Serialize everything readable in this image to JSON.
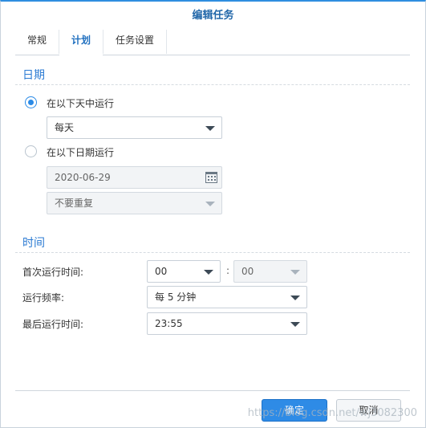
{
  "dialog": {
    "title": "编辑任务"
  },
  "tabs": [
    {
      "label": "常规",
      "active": false
    },
    {
      "label": "计划",
      "active": true
    },
    {
      "label": "任务设置",
      "active": false
    }
  ],
  "date_section": {
    "title": "日期",
    "option_daily": {
      "label": "在以下天中运行",
      "checked": true
    },
    "daily_select": {
      "value": "每天"
    },
    "option_specific": {
      "label": "在以下日期运行",
      "checked": false
    },
    "date_field": {
      "value": "2020-06-29"
    },
    "repeat_select": {
      "value": "不要重复"
    }
  },
  "time_section": {
    "title": "时间",
    "first_run": {
      "label": "首次运行时间:",
      "hour": "00",
      "separator": ":",
      "minute": "00"
    },
    "frequency": {
      "label": "运行频率:",
      "value": "每 5 分钟"
    },
    "last_run": {
      "label": "最后运行时间:",
      "value": "23:55"
    }
  },
  "footer": {
    "ok_label": "确定",
    "cancel_label": "取消"
  },
  "watermark": "https://blog.csdn.net/wj3082300",
  "colors": {
    "accent": "#2e8be6",
    "title": "#2167a9",
    "section": "#2c7bd3"
  }
}
